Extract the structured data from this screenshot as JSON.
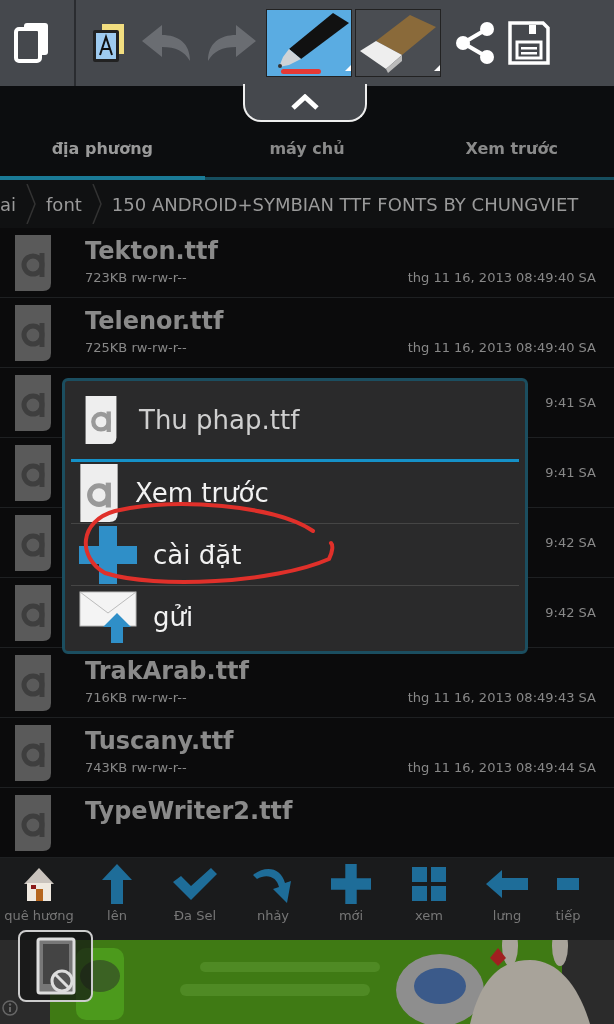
{
  "toolbar": {
    "left": [
      {
        "kind": "pages"
      },
      {
        "kind": "text-image"
      },
      {
        "kind": "undo",
        "disabled": true
      },
      {
        "kind": "redo",
        "disabled": true
      }
    ],
    "tools": [
      {
        "kind": "pen",
        "selected": true
      },
      {
        "kind": "eraser",
        "selected": false
      }
    ],
    "right": [
      {
        "kind": "share"
      },
      {
        "kind": "save"
      }
    ]
  },
  "tabs": [
    {
      "label": "địa phương",
      "selected": true
    },
    {
      "label": "máy chủ",
      "selected": false
    },
    {
      "label": "Xem trước",
      "selected": false
    }
  ],
  "breadcrumb": [
    "ai",
    "font",
    "150 ANDROID+SYMBIAN TTF FONTS BY CHUNGVIET"
  ],
  "files": [
    {
      "name": "Tekton.ttf",
      "meta": "723KB rw-rw-r--",
      "date": "thg 11 16, 2013 08:49:40 SA"
    },
    {
      "name": "Telenor.ttf",
      "meta": "725KB rw-rw-r--",
      "date": "thg 11 16, 2013 08:49:40 SA"
    },
    {
      "date": "9:41 SA"
    },
    {
      "date": "9:41 SA"
    },
    {
      "date": "9:42 SA"
    },
    {
      "date": "9:42 SA"
    },
    {
      "name": "TrakArab.ttf",
      "meta": "716KB rw-rw-r--",
      "date": "thg 11 16, 2013 08:49:43 SA"
    },
    {
      "name": "Tuscany.ttf",
      "meta": "743KB rw-rw-r--",
      "date": "thg 11 16, 2013 08:49:44 SA"
    },
    {
      "name": "TypeWriter2.ttf"
    }
  ],
  "dialog": {
    "title": "Thu phap.ttf",
    "items": [
      {
        "kind": "preview",
        "label": "Xem trước"
      },
      {
        "kind": "install",
        "label": "cài đặt"
      },
      {
        "kind": "send",
        "label": "gửi"
      }
    ]
  },
  "bottom_bar": [
    {
      "kind": "home",
      "label": "quê hương"
    },
    {
      "kind": "up",
      "label": "lên"
    },
    {
      "kind": "check",
      "label": "Đa Sel"
    },
    {
      "kind": "jump",
      "label": "nhảy"
    },
    {
      "kind": "new",
      "label": "mới"
    },
    {
      "kind": "view",
      "label": "xem"
    },
    {
      "kind": "back",
      "label": "lưng"
    },
    {
      "kind": "next",
      "label": "tiếp"
    }
  ],
  "banner": {
    "kind": "picture"
  }
}
